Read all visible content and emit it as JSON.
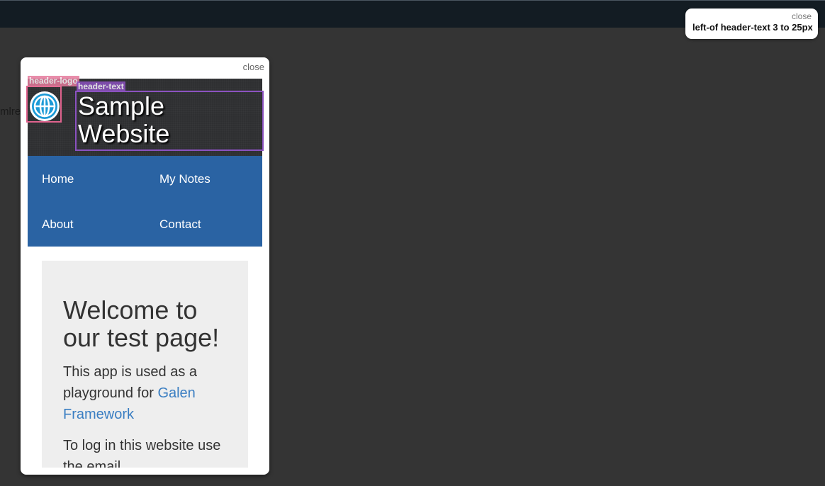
{
  "info_popup": {
    "close_label": "close",
    "message": "left-of header-text 3 to 25px"
  },
  "background": {
    "peek_text": "mlre"
  },
  "screenshot_popup": {
    "close_label": "close",
    "site": {
      "logo_icon": "globe-icon",
      "header_title_line1": "Sample",
      "header_title_line2": "Website",
      "menu": [
        {
          "label": "Home"
        },
        {
          "label": "My Notes"
        },
        {
          "label": "About"
        },
        {
          "label": "Contact"
        }
      ],
      "content": {
        "heading_line1": "Welcome to",
        "heading_line2": "our test page!",
        "para1_text": "This app is used as a playground for",
        "para1_link": "Galen Framework",
        "para2_text": "To log in this website use the email"
      }
    },
    "highlights": [
      {
        "label": "header-logo",
        "color": "#e0638e"
      },
      {
        "label": "header-text",
        "color": "#8b52c0"
      }
    ]
  },
  "colors": {
    "page_bg": "#343434",
    "topbar": "#131c23",
    "menu_bg": "#2a63a3",
    "link": "#3a7ec2"
  }
}
